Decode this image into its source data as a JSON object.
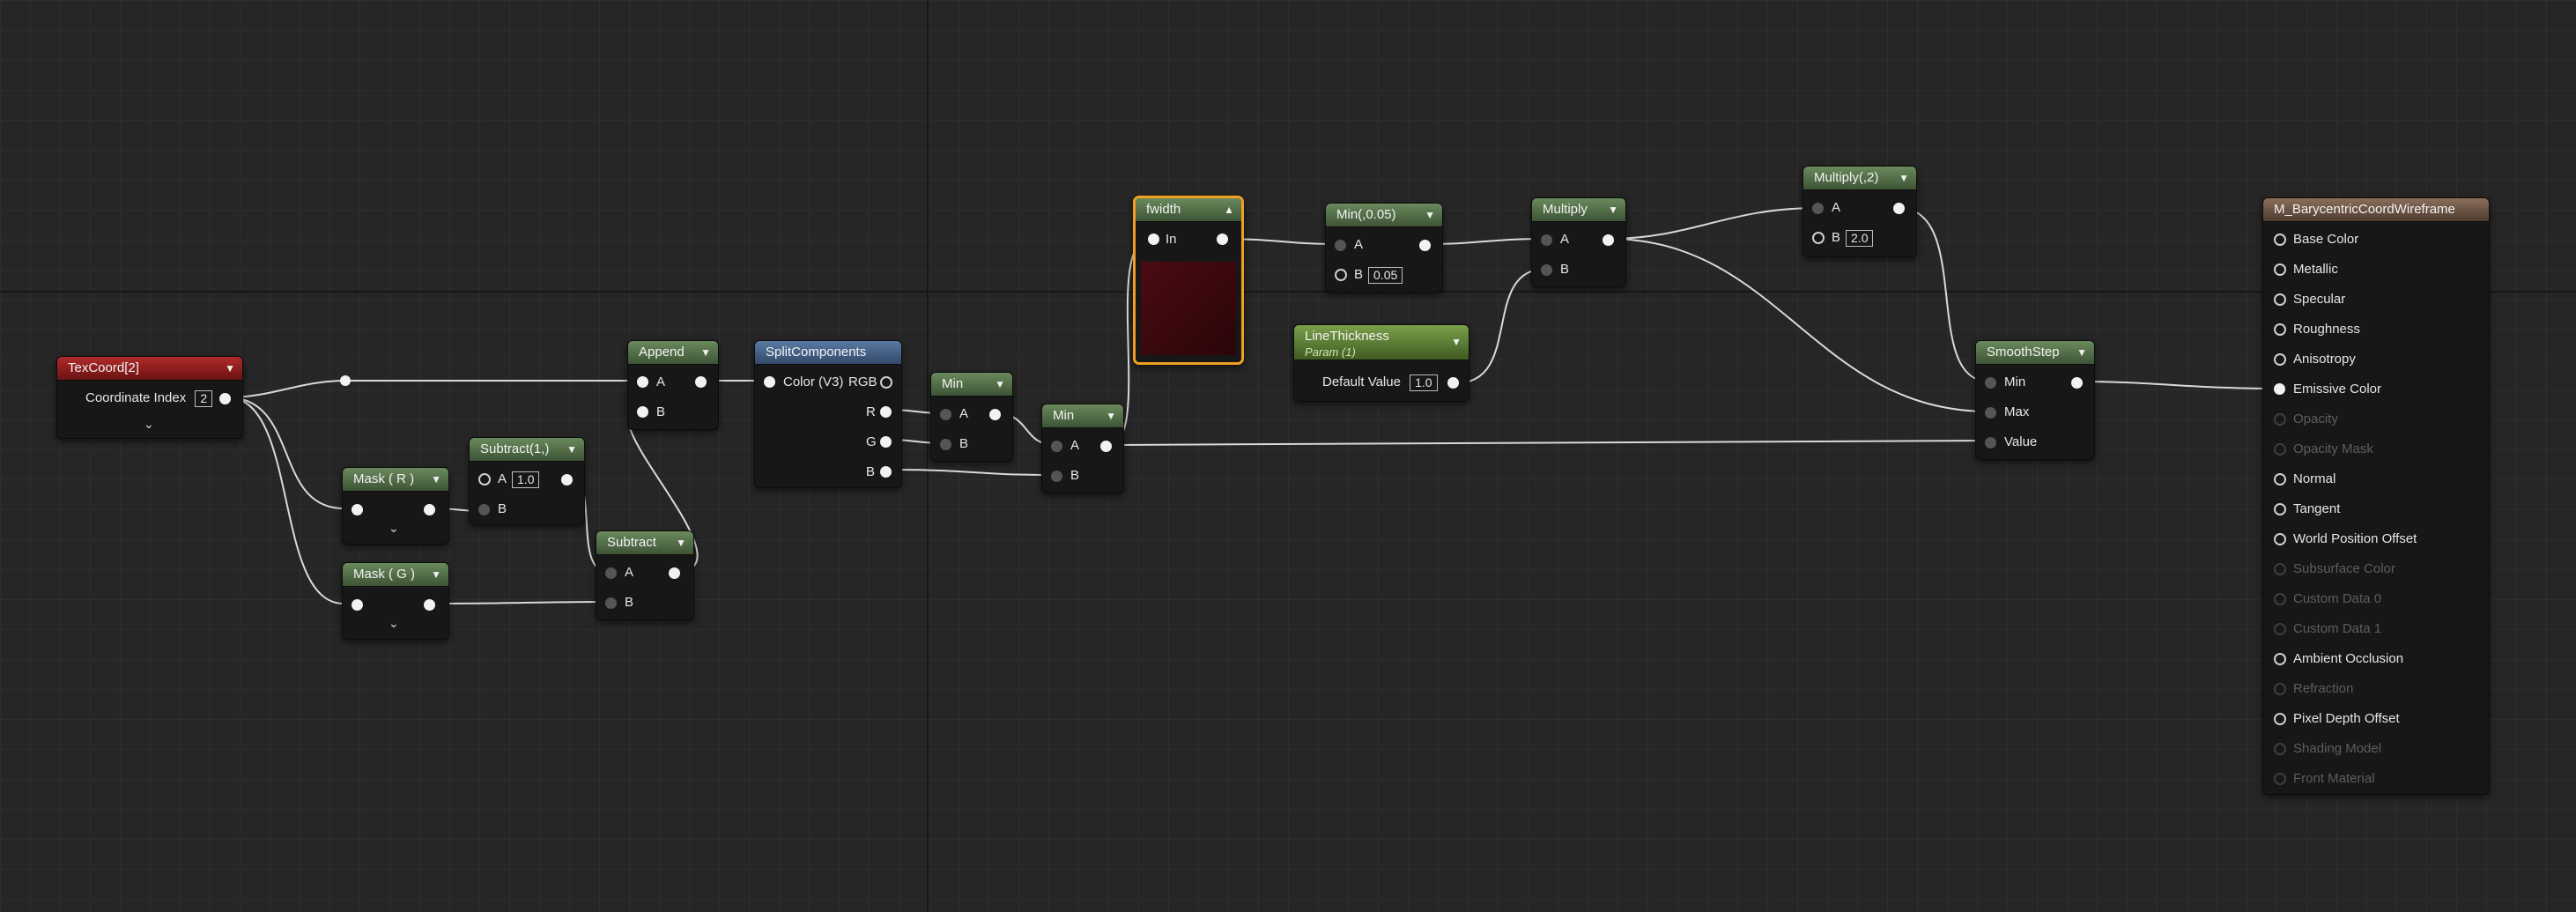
{
  "nodes": {
    "texcoord": {
      "title": "TexCoord[2]",
      "label": "Coordinate Index",
      "value": "2"
    },
    "mask_r": {
      "title": "Mask ( R )"
    },
    "mask_g": {
      "title": "Mask ( G )"
    },
    "subtract1": {
      "title": "Subtract(1,)",
      "a_label": "A",
      "a_value": "1.0",
      "b_label": "B"
    },
    "subtract": {
      "title": "Subtract",
      "a_label": "A",
      "b_label": "B"
    },
    "append": {
      "title": "Append",
      "a_label": "A",
      "b_label": "B"
    },
    "split": {
      "title": "SplitComponents",
      "in_label": "Color (V3)",
      "rgb": "RGB",
      "r": "R",
      "g": "G",
      "b": "B"
    },
    "min1": {
      "title": "Min",
      "a_label": "A",
      "b_label": "B"
    },
    "min2": {
      "title": "Min",
      "a_label": "A",
      "b_label": "B"
    },
    "fwidth": {
      "title": "fwidth",
      "in_label": "In"
    },
    "min005": {
      "title": "Min(,0.05)",
      "a_label": "A",
      "b_label": "B",
      "b_value": "0.05"
    },
    "linethickness": {
      "title": "LineThickness",
      "subtitle": "Param (1)",
      "label": "Default Value",
      "value": "1.0"
    },
    "multiply": {
      "title": "Multiply",
      "a_label": "A",
      "b_label": "B"
    },
    "multiply2": {
      "title": "Multiply(,2)",
      "a_label": "A",
      "b_label": "B",
      "b_value": "2.0"
    },
    "smoothstep": {
      "title": "SmoothStep",
      "min": "Min",
      "max": "Max",
      "value": "Value"
    }
  },
  "material": {
    "title": "M_BarycentricCoordWireframe",
    "inputs": [
      {
        "label": "Base Color",
        "active": true
      },
      {
        "label": "Metallic",
        "active": true
      },
      {
        "label": "Specular",
        "active": true
      },
      {
        "label": "Roughness",
        "active": true
      },
      {
        "label": "Anisotropy",
        "active": true
      },
      {
        "label": "Emissive Color",
        "active": true,
        "connected": true
      },
      {
        "label": "Opacity",
        "active": false
      },
      {
        "label": "Opacity Mask",
        "active": false
      },
      {
        "label": "Normal",
        "active": true
      },
      {
        "label": "Tangent",
        "active": true
      },
      {
        "label": "World Position Offset",
        "active": true
      },
      {
        "label": "Subsurface Color",
        "active": false
      },
      {
        "label": "Custom Data 0",
        "active": false
      },
      {
        "label": "Custom Data 1",
        "active": false
      },
      {
        "label": "Ambient Occlusion",
        "active": true
      },
      {
        "label": "Refraction",
        "active": false
      },
      {
        "label": "Pixel Depth Offset",
        "active": true
      },
      {
        "label": "Shading Model",
        "active": false
      },
      {
        "label": "Front Material",
        "active": false
      }
    ]
  },
  "colors": {
    "wire": "#d9d9d9",
    "selection": "#f0a020",
    "preview": "#3a0a0e"
  }
}
